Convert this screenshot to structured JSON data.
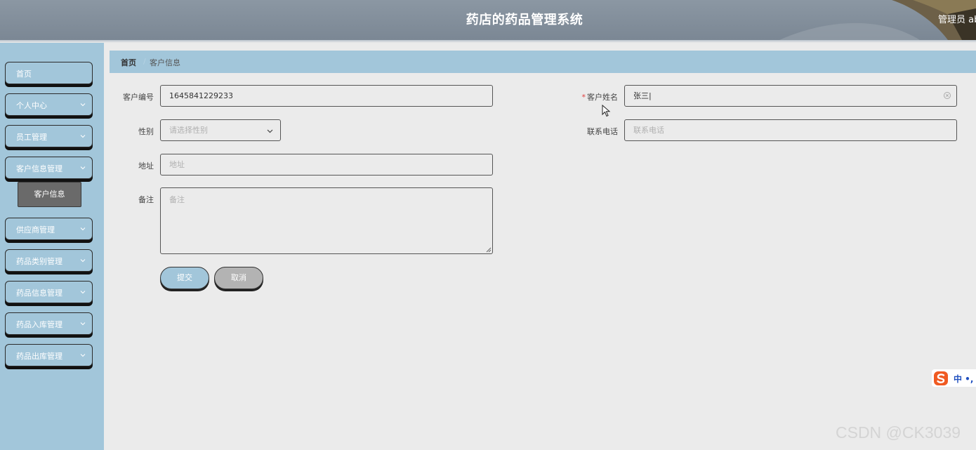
{
  "header": {
    "title": "药店的药品管理系统",
    "user": "管理员 abo"
  },
  "sidebar": {
    "items": [
      {
        "label": "首页"
      },
      {
        "label": "个人中心"
      },
      {
        "label": "员工管理"
      },
      {
        "label": "客户信息管理"
      },
      {
        "label": "供应商管理"
      },
      {
        "label": "药品类别管理"
      },
      {
        "label": "药品信息管理"
      },
      {
        "label": "药品入库管理"
      },
      {
        "label": "药品出库管理"
      }
    ],
    "active_sub": "客户信息"
  },
  "breadcrumb": {
    "home": "首页",
    "sep": "/",
    "current": "客户信息"
  },
  "form": {
    "customer_id": {
      "label": "客户编号",
      "value": "1645841229233"
    },
    "customer_name": {
      "label": "客户姓名",
      "required": "*",
      "value": "张三|"
    },
    "gender": {
      "label": "性别",
      "placeholder": "请选择性别"
    },
    "phone": {
      "label": "联系电话",
      "placeholder": "联系电话"
    },
    "address": {
      "label": "地址",
      "placeholder": "地址"
    },
    "remark": {
      "label": "备注",
      "placeholder": "备注"
    },
    "submit_label": "提交",
    "cancel_label": "取消"
  },
  "ime": {
    "text": "中 •,"
  },
  "watermark": "CSDN @CK3039",
  "colors": {
    "header": "#7f8b97",
    "sidebar": "#a2c6da",
    "background": "#ebebeb",
    "submit": "#a2c6da",
    "cancel": "#b3b3b3",
    "required": "#e04040"
  }
}
